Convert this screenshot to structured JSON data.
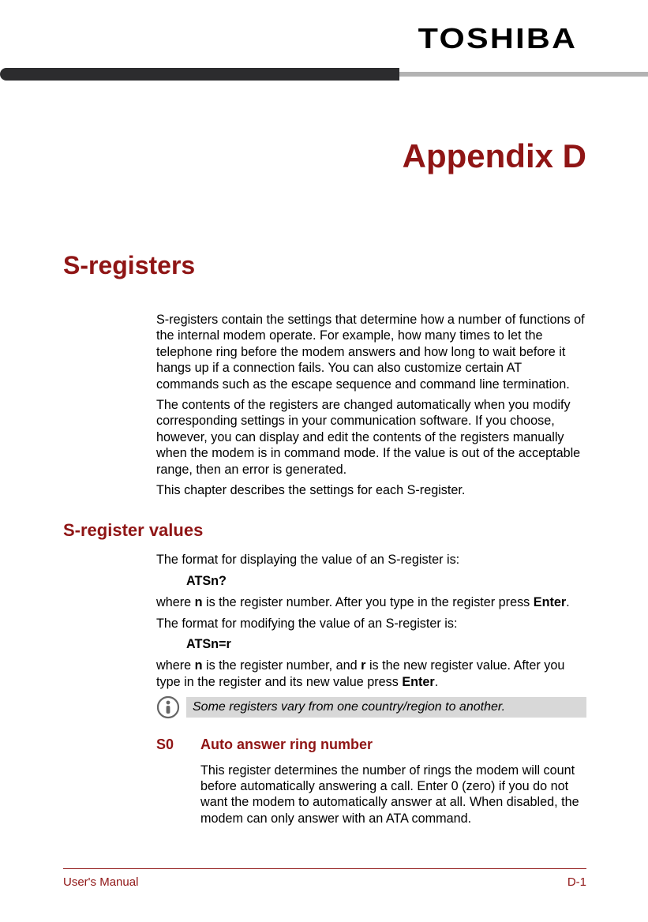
{
  "brand": "TOSHIBA",
  "appendix_title": "Appendix D",
  "section_title": "S-registers",
  "intro": {
    "p1": "S-registers contain the settings that determine how a number of functions of the internal modem operate. For example, how many times to let the telephone ring before the modem answers and how long to wait before it hangs up if a connection fails. You can also customize certain AT commands such as the escape sequence and command line termination.",
    "p2": "The contents of the registers are changed automatically when you modify corresponding settings in your communication software. If you choose, however, you can display and edit the contents of the registers manually when the modem is in command mode. If the value is out of the acceptable range, then an error is generated.",
    "p3": "This chapter describes the settings for each S-register."
  },
  "values_heading": "S-register values",
  "values": {
    "p1": "The format for displaying the value of an S-register is:",
    "cmd1": "ATSn?",
    "p2_a": "where ",
    "p2_b": "n",
    "p2_c": " is the register number. After you type in the register press ",
    "p2_d": "Enter",
    "p2_e": ".",
    "p3": "The format for modifying the value of an S-register is:",
    "cmd2": "ATSn=r",
    "p4_a": "where ",
    "p4_b": "n",
    "p4_c": " is the register number, and ",
    "p4_d": "r",
    "p4_e": " is the new register value. After you type in the register and its new value press ",
    "p4_f": "Enter",
    "p4_g": "."
  },
  "note": "Some registers vary from one country/region to another.",
  "register": {
    "code": "S0",
    "title": "Auto answer ring number",
    "body": "This register determines the number of rings the modem will count before automatically answering a call. Enter 0 (zero) if you do not want the modem to automatically answer at all. When disabled, the modem can only answer with an ATA command."
  },
  "footer": {
    "left": "User's Manual",
    "right": "D-1"
  }
}
